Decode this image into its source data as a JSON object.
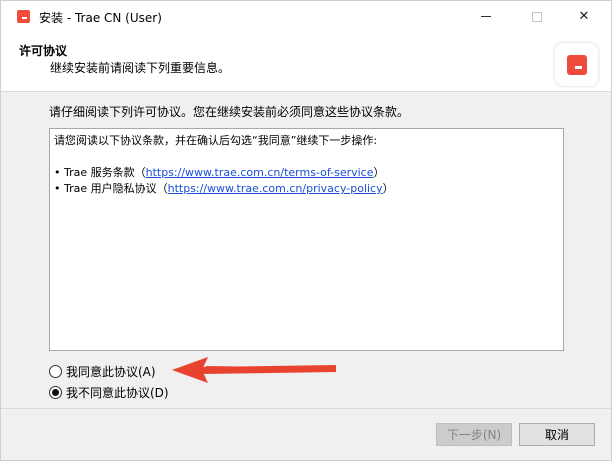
{
  "window": {
    "title": "安装 - Trae CN (User)",
    "controls": {
      "minimize": "—",
      "maximize": "☐",
      "close": "✕"
    }
  },
  "header": {
    "title": "许可协议",
    "subtitle": "继续安装前请阅读下列重要信息。"
  },
  "main": {
    "instruction": "请仔细阅读下列许可协议。您在继续安装前必须同意这些协议条款。",
    "license": {
      "intro": "请您阅读以下协议条款，并在确认后勾选“我同意”继续下一步操作:",
      "items": [
        {
          "prefix": "• Trae 服务条款（",
          "link": "https://www.trae.com.cn/terms-of-service",
          "suffix": "）"
        },
        {
          "prefix": "• Trae 用户隐私协议（",
          "link": "https://www.trae.com.cn/privacy-policy",
          "suffix": "）"
        }
      ]
    },
    "options": {
      "agree": "我同意此协议(A)",
      "disagree": "我不同意此协议(D)",
      "selected": "disagree"
    }
  },
  "footer": {
    "next_label": "下一步(N)",
    "cancel_label": "取消"
  },
  "colors": {
    "accent_red": "#ef4b3c",
    "arrow": "#e8432f",
    "link": "#1a4fd6"
  }
}
